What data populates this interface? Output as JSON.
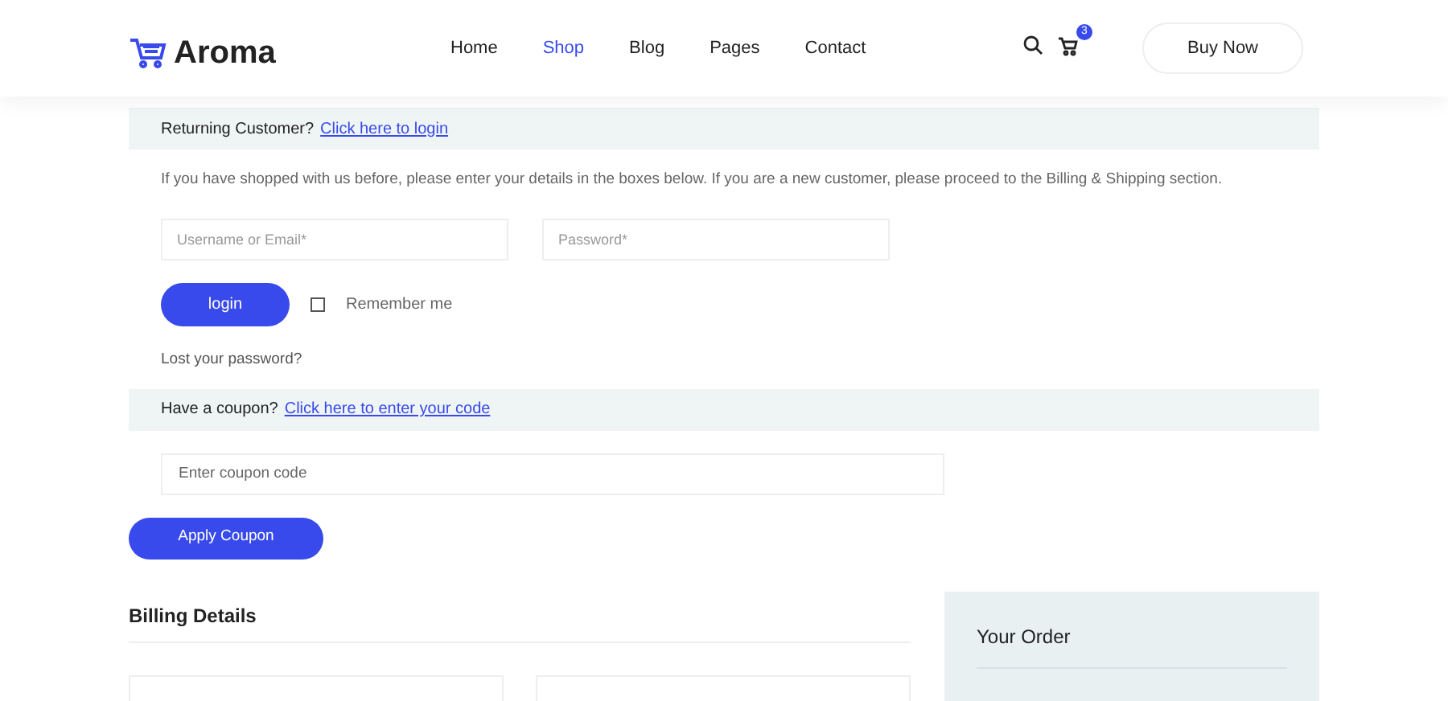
{
  "header": {
    "logo": "Aroma",
    "nav": [
      {
        "label": "Home",
        "selected": false
      },
      {
        "label": "Shop",
        "selected": true
      },
      {
        "label": "Blog",
        "selected": false
      },
      {
        "label": "Pages",
        "selected": false
      },
      {
        "label": "Contact",
        "selected": false
      }
    ],
    "cart_count": "3",
    "button": "Buy Now"
  },
  "login": {
    "notice": "Returning Customer?",
    "link": "Click here to login",
    "intro": "If you have shopped with us before, please enter your details in the boxes below. If you are a new customer, please proceed to the Billing & Shipping section.",
    "username": {
      "placeholder": "Username or Email*"
    },
    "password": {
      "placeholder": "Password*"
    },
    "button": "login",
    "remember": {
      "label": "Remember me",
      "checked": false
    },
    "lost": "Lost your password?"
  },
  "coupon": {
    "notice": "Have a coupon?",
    "link": "Click here to enter your code",
    "field": {
      "placeholder": "Enter coupon code"
    },
    "button": "Apply Coupon"
  },
  "billing": {
    "title": "Billing Details"
  },
  "order": {
    "title": "Your Order"
  }
}
